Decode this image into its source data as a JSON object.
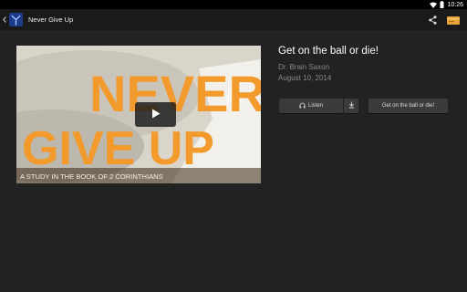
{
  "status": {
    "time": "10:26"
  },
  "app": {
    "title": "Never Give Up"
  },
  "sermon": {
    "title": "Get on the ball or die!",
    "speaker": "Dr. Brain Saxon",
    "date": "August 10, 2014"
  },
  "video": {
    "line1": "NEVER",
    "line2": "GIVE UP",
    "subtitle": "A STUDY IN THE BOOK OF 2 CORINTHIANS"
  },
  "buttons": {
    "listen": "Listen",
    "sermon_link": "Get on the ball or die!"
  },
  "colors": {
    "accent_orange": "#f39a2c",
    "background": "#222222",
    "button": "#3b3b3b"
  },
  "icons": [
    "back-chevron",
    "app-logo",
    "share-icon",
    "gift-card-icon",
    "play-icon",
    "headphones-icon",
    "download-icon",
    "wifi-icon",
    "battery-icon"
  ]
}
